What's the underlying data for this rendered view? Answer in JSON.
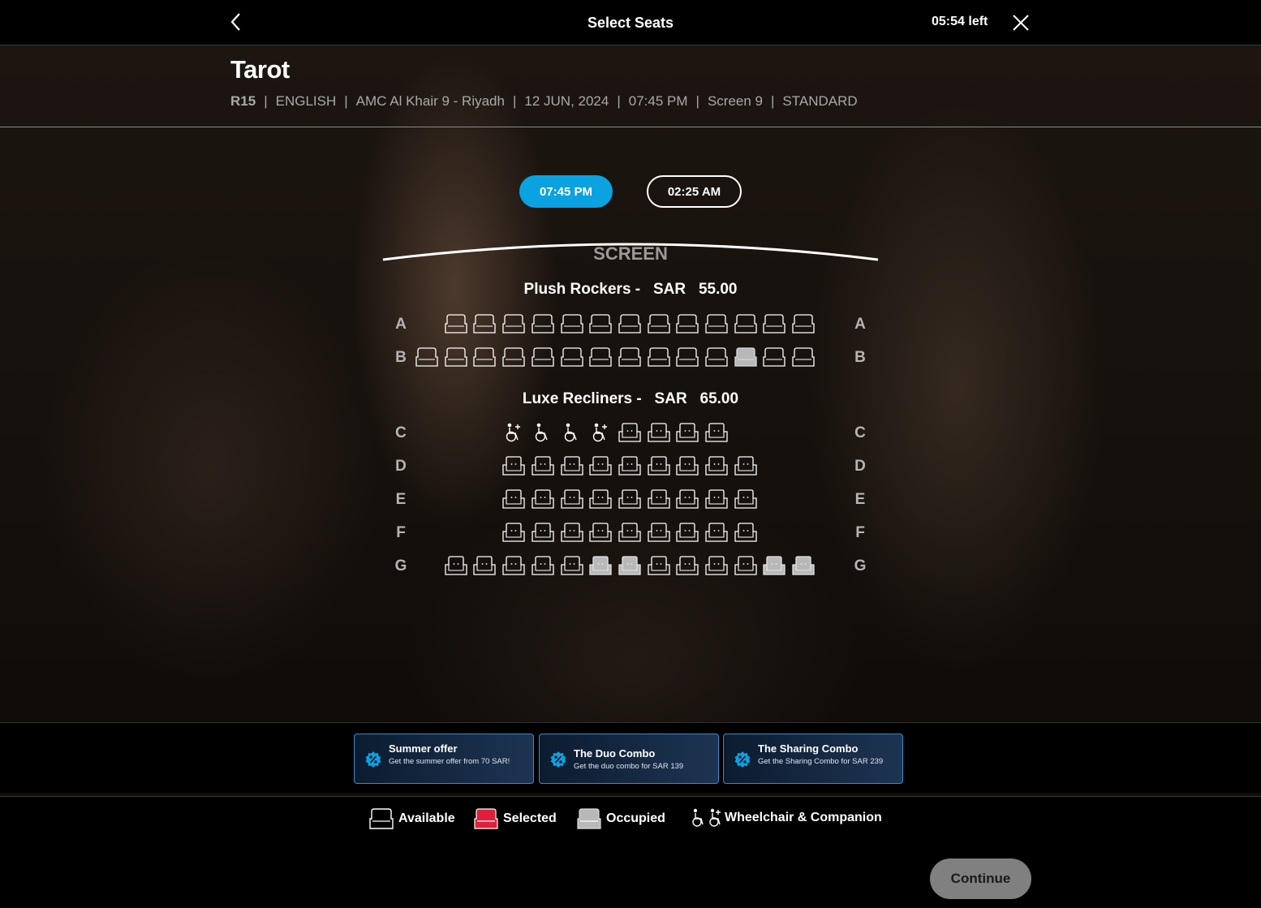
{
  "header": {
    "title": "Select Seats",
    "timer": "05:54 left"
  },
  "movie": {
    "title": "Tarot",
    "rating": "R15",
    "language": "ENGLISH",
    "cinema": "AMC Al Khair 9 - Riyadh",
    "date": "12 JUN, 2024",
    "time": "07:45 PM",
    "screen": "Screen 9",
    "format": "STANDARD",
    "separator": "|"
  },
  "showtimes": [
    {
      "label": "07:45 PM",
      "selected": true
    },
    {
      "label": "02:25 AM",
      "selected": false
    }
  ],
  "screen_label": "SCREEN",
  "sections": [
    {
      "name": "Plush Rockers -",
      "currency": "SAR",
      "price": "55.00"
    },
    {
      "name": "Luxe Recliners -",
      "currency": "SAR",
      "price": "65.00"
    }
  ],
  "rows": [
    {
      "label": "A",
      "seats": [
        "gap",
        "available",
        "available",
        "available",
        "available",
        "available",
        "available",
        "available",
        "available",
        "available",
        "available",
        "available",
        "available",
        "available"
      ]
    },
    {
      "label": "B",
      "seats": [
        "available",
        "available",
        "available",
        "available",
        "available",
        "available",
        "available",
        "available",
        "available",
        "available",
        "available",
        "occupied",
        "available",
        "available"
      ]
    },
    {
      "label": "C",
      "seats": [
        "gap",
        "gap",
        "gap",
        "wheelchair",
        "companion",
        "companion",
        "wheelchair",
        "recliner",
        "recliner",
        "recliner",
        "recliner"
      ]
    },
    {
      "label": "D",
      "seats": [
        "gap",
        "gap",
        "gap",
        "recliner",
        "recliner",
        "recliner",
        "recliner",
        "recliner",
        "recliner",
        "recliner",
        "recliner",
        "recliner"
      ]
    },
    {
      "label": "E",
      "seats": [
        "gap",
        "gap",
        "gap",
        "recliner",
        "recliner",
        "recliner",
        "recliner",
        "recliner",
        "recliner",
        "recliner",
        "recliner",
        "recliner"
      ]
    },
    {
      "label": "F",
      "seats": [
        "gap",
        "gap",
        "gap",
        "recliner",
        "recliner",
        "recliner",
        "recliner",
        "recliner",
        "recliner",
        "recliner",
        "recliner",
        "recliner"
      ]
    },
    {
      "label": "G",
      "seats": [
        "gap",
        "recliner",
        "recliner",
        "recliner",
        "recliner",
        "recliner",
        "recliner-occupied",
        "recliner-occupied",
        "recliner",
        "recliner",
        "recliner",
        "recliner",
        "recliner-occupied",
        "recliner-occupied"
      ]
    }
  ],
  "offers": [
    {
      "title": "Summer offer",
      "desc": "Get the summer offer from 70 SAR!"
    },
    {
      "title": "The Duo Combo",
      "desc": "Get the duo combo for SAR 139"
    },
    {
      "title": "The Sharing Combo",
      "desc": "Get the Sharing Combo for SAR 239"
    }
  ],
  "legend": {
    "available": "Available",
    "selected": "Selected",
    "occupied": "Occupied",
    "wheelchair": "Wheelchair & Companion"
  },
  "colors": {
    "accent": "#0aa2e0",
    "selected": "#e0203a",
    "occupied": "#b8b8b8",
    "offer_border": "#2b8fd8"
  },
  "continue_label": "Continue"
}
